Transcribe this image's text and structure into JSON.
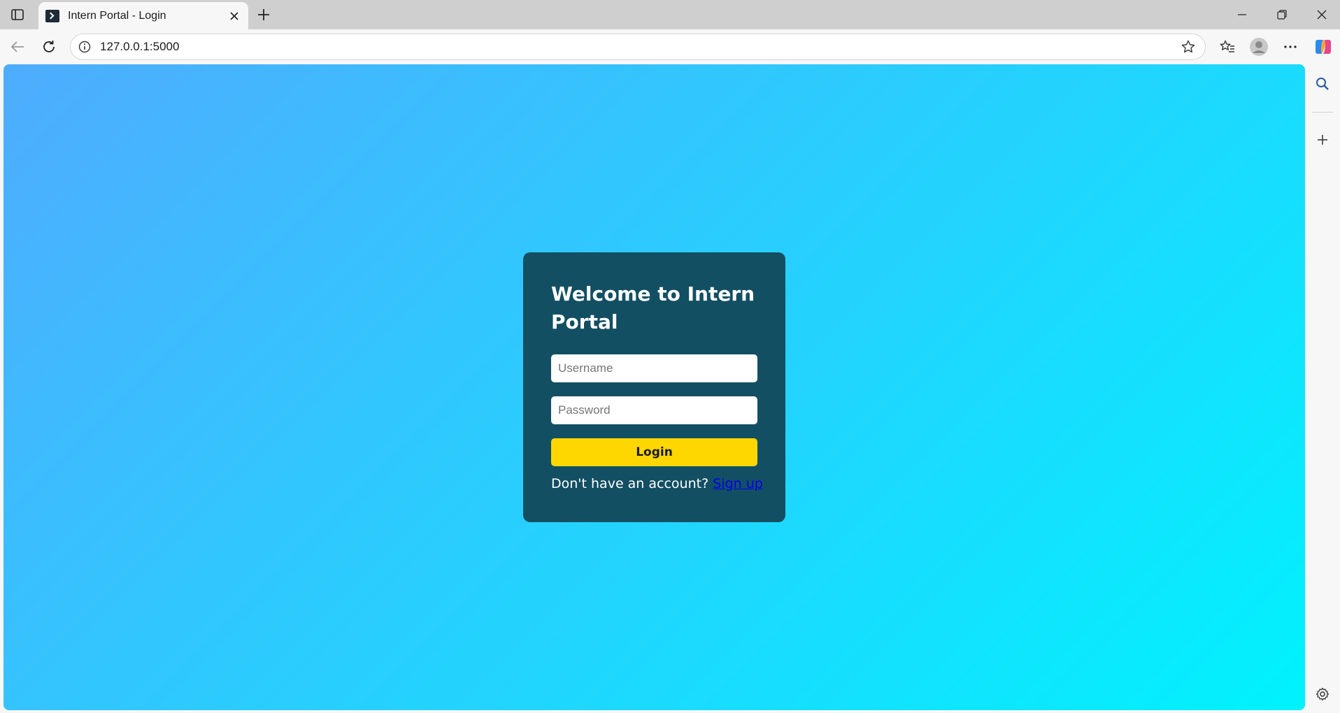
{
  "browser": {
    "tab_title": "Intern Portal - Login",
    "url": "127.0.0.1:5000"
  },
  "page": {
    "heading": "Welcome to Intern Portal",
    "username_placeholder": "Username",
    "password_placeholder": "Password",
    "login_label": "Login",
    "signup_prompt": "Don't have an account?",
    "signup_link": "Sign up"
  },
  "colors": {
    "gradient_start": "#4facfe",
    "gradient_end": "#00f2fe",
    "card_background": "#134f63",
    "login_button": "#ffd700",
    "link": "#0000ee"
  },
  "icons": {
    "tab_actions": "tab-actions-icon",
    "new_tab": "plus-icon",
    "minimize": "minimize-icon",
    "restore": "restore-icon",
    "close": "close-icon",
    "back": "back-arrow-icon",
    "refresh": "refresh-icon",
    "site_info": "info-icon",
    "favorite": "star-icon",
    "favorites": "favorites-icon",
    "profile": "profile-icon",
    "more": "more-icon",
    "copilot": "copilot-icon",
    "search": "search-icon",
    "add": "plus-icon",
    "settings": "gear-icon"
  }
}
